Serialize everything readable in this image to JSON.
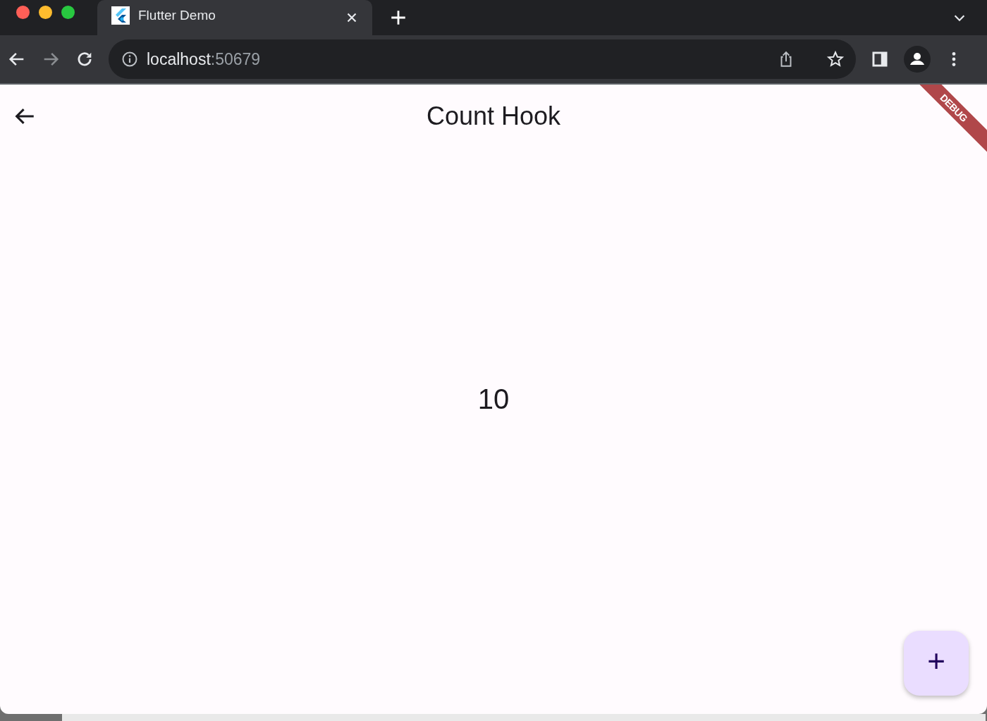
{
  "browser": {
    "tab": {
      "title": "Flutter Demo",
      "selected": true
    },
    "url": {
      "host": "localhost",
      "port": ":50679"
    }
  },
  "app_bar": {
    "title": "Count Hook"
  },
  "debug_banner": "DEBUG",
  "counter": "10",
  "fab": {
    "label": "+"
  }
}
